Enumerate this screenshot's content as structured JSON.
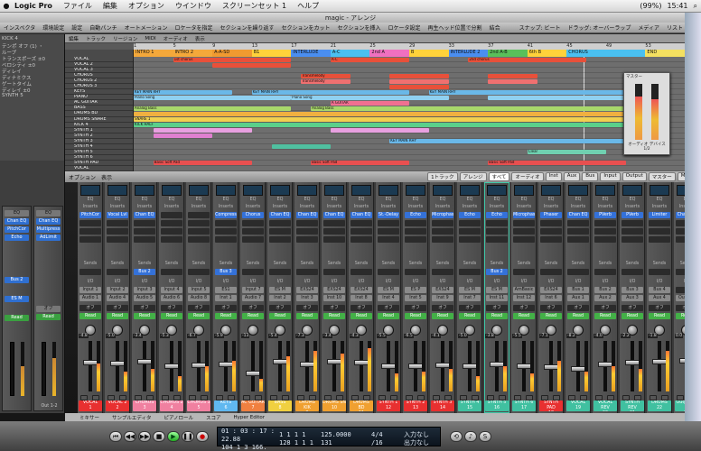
{
  "menubar": {
    "apple": "",
    "app": "Logic Pro",
    "items": [
      "ファイル",
      "編集",
      "オプション",
      "ウインドウ",
      "スクリーンセット 1",
      "ヘルプ"
    ],
    "clock": "15:41",
    "battery": "(99%)"
  },
  "window": {
    "title": "magic - アレンジ"
  },
  "toolbar": {
    "items": [
      "インスペクタ",
      "環境設定",
      "設定",
      "自動パンチ",
      "オートメーション",
      "ロケータを指定",
      "セクションを繰り返す",
      "セクションをカット",
      "セクションを挿入",
      "ロケータ設定",
      "再生ヘッド位置で分割",
      "結合"
    ],
    "right": [
      "スナップ: ビート",
      "ドラッグ: オーバーラップ",
      "メディア",
      "リスト",
      "メモ"
    ]
  },
  "inspector": {
    "top_items": [
      "KICK 4",
      "テンポ オフ (1) ・",
      "ループ",
      "トランスポーズ ±0",
      "ベロシティ ±0",
      "ディレイ",
      "ディナミクス",
      "ゲートタイム",
      "ディレイ ±0",
      "SYNTH 5"
    ],
    "left_plugs": [
      "Chan EQ",
      "PitchCor",
      "Echo"
    ],
    "right_plugs": [
      "Chan EQ",
      "Multipress",
      "AdLimit"
    ],
    "send": "Bus 2",
    "io": "ES M",
    "read": "Read",
    "auto": "オフ",
    "pan_val": "-4.4",
    "bottom": "Out 1-2"
  },
  "arrange": {
    "tools": [
      "編集",
      "トラック",
      "リージョン",
      "MIDI",
      "オーディオ",
      "表示"
    ],
    "ruler": [
      "1",
      "5",
      "9",
      "13",
      "17",
      "21",
      "25",
      "29",
      "33",
      "37",
      "41",
      "45",
      "49",
      "53",
      "57",
      "61",
      "65",
      "69",
      "73",
      "77",
      "81",
      "85",
      "89",
      "93",
      "97",
      "101",
      "105",
      "109"
    ],
    "markers": [
      {
        "label": "INTRO 1",
        "color": "#f4a83a",
        "start": 0,
        "len": 4
      },
      {
        "label": "INTRO 2",
        "color": "#f4a83a",
        "start": 4,
        "len": 4
      },
      {
        "label": "A-A-SD",
        "color": "#f09a30",
        "start": 8,
        "len": 4
      },
      {
        "label": "B1",
        "color": "#ffd23a",
        "start": 12,
        "len": 4
      },
      {
        "label": "INTERLUDE",
        "color": "#4a8ef0",
        "start": 16,
        "len": 4
      },
      {
        "label": "A-C",
        "color": "#4ac0f0",
        "start": 20,
        "len": 4
      },
      {
        "label": "2nd A",
        "color": "#f070c0",
        "start": 24,
        "len": 4
      },
      {
        "label": "B",
        "color": "#ffd23a",
        "start": 28,
        "len": 4
      },
      {
        "label": "INTERLUDE 2",
        "color": "#4a8ef0",
        "start": 32,
        "len": 4
      },
      {
        "label": "2nd A-B",
        "color": "#5ac05a",
        "start": 36,
        "len": 4
      },
      {
        "label": "6th B",
        "color": "#ffd23a",
        "start": 40,
        "len": 4
      },
      {
        "label": "CHORUS",
        "color": "#4ac0f0",
        "start": 44,
        "len": 8
      },
      {
        "label": "END",
        "color": "#f4e060",
        "start": 52,
        "len": 4
      }
    ],
    "tracks": [
      "VOCAL",
      "VOCAL 2",
      "VOCAL 3",
      "CHORUS",
      "CHORUS 2",
      "CHORUS 3",
      "KEYS",
      "PIANO",
      "AC GUITAR",
      "BASS",
      "DRUMS BD",
      "DRUMS SNARE",
      "KICK 4",
      "SYNTH 1",
      "SYNTH 2",
      "SYNTH 3",
      "SYNTH 4",
      "SYNTH 5",
      "SYNTH 6",
      "SYNTH PAD",
      "VOCAL"
    ],
    "regions": [
      {
        "track": 0,
        "label": "1st chorus",
        "start": 4,
        "len": 12,
        "color": "#e8503a"
      },
      {
        "track": 0,
        "label": "A-C",
        "start": 20,
        "len": 8,
        "color": "#e8503a"
      },
      {
        "track": 0,
        "label": "2nd chorus",
        "start": 34,
        "len": 12,
        "color": "#e8503a"
      },
      {
        "track": 1,
        "label": "",
        "start": 8,
        "len": 8,
        "color": "#e8503a"
      },
      {
        "track": 3,
        "label": "Transmelody",
        "start": 17,
        "len": 5,
        "color": "#e8503a"
      },
      {
        "track": 3,
        "label": "",
        "start": 26,
        "len": 6,
        "color": "#e8503a"
      },
      {
        "track": 3,
        "label": "",
        "start": 36,
        "len": 5,
        "color": "#e8503a"
      },
      {
        "track": 4,
        "label": "Transmelody",
        "start": 17,
        "len": 5,
        "color": "#f07070"
      },
      {
        "track": 4,
        "label": "",
        "start": 26,
        "len": 6,
        "color": "#f07070"
      },
      {
        "track": 4,
        "label": "",
        "start": 36,
        "len": 5,
        "color": "#f07070"
      },
      {
        "track": 5,
        "label": "",
        "start": 26,
        "len": 6,
        "color": "#e8503a"
      },
      {
        "track": 6,
        "label": "KEY MAIN RHY",
        "start": 0,
        "len": 10,
        "color": "#6ab8e8"
      },
      {
        "track": 6,
        "label": "KEY MAIN RHY",
        "start": 12,
        "len": 16,
        "color": "#6ab8e8"
      },
      {
        "track": 6,
        "label": "KEY MAIN RHY",
        "start": 30,
        "len": 24,
        "color": "#6ab8e8"
      },
      {
        "track": 7,
        "label": "Piano Song",
        "start": 0,
        "len": 16,
        "color": "#8fd0f0"
      },
      {
        "track": 7,
        "label": "Piano Song",
        "start": 16,
        "len": 16,
        "color": "#8fd0f0"
      },
      {
        "track": 7,
        "label": "",
        "start": 36,
        "len": 16,
        "color": "#8fd0f0"
      },
      {
        "track": 8,
        "label": "A GUITAR",
        "start": 20,
        "len": 8,
        "color": "#f07090"
      },
      {
        "track": 9,
        "label": "Analog Bass",
        "start": 0,
        "len": 16,
        "color": "#a8d86a"
      },
      {
        "track": 9,
        "label": "Analog Bass",
        "start": 18,
        "len": 34,
        "color": "#a8d86a"
      },
      {
        "track": 10,
        "label": "",
        "start": 0,
        "len": 52,
        "color": "#f0b040"
      },
      {
        "track": 11,
        "label": "SNARE 1",
        "start": 0,
        "len": 52,
        "color": "#f0d050"
      },
      {
        "track": 12,
        "label": "KICK HALF",
        "start": 0,
        "len": 52,
        "color": "#5ad08a"
      },
      {
        "track": 13,
        "label": "",
        "start": 2,
        "len": 10,
        "color": "#e8a0e0"
      },
      {
        "track": 13,
        "label": "",
        "start": 20,
        "len": 10,
        "color": "#e8a0e0"
      },
      {
        "track": 14,
        "label": "",
        "start": 2,
        "len": 6,
        "color": "#e080d0"
      },
      {
        "track": 15,
        "label": "KEY MAIN RHY",
        "start": 26,
        "len": 24,
        "color": "#6ab8e8"
      },
      {
        "track": 16,
        "label": "",
        "start": 14,
        "len": 6,
        "color": "#50c0a0"
      },
      {
        "track": 17,
        "label": "Clear",
        "start": 40,
        "len": 8,
        "color": "#70d0b0"
      },
      {
        "track": 19,
        "label": "Basic Soft Pad",
        "start": 2,
        "len": 10,
        "color": "#e85050"
      },
      {
        "track": 19,
        "label": "Basic Soft Pad",
        "start": 18,
        "len": 10,
        "color": "#e85050"
      },
      {
        "track": 19,
        "label": "Basic Soft Pad",
        "start": 36,
        "len": 14,
        "color": "#e85050"
      }
    ],
    "float": {
      "label": "オーディオ デバイス 1/2",
      "title": "マスター"
    }
  },
  "mixer": {
    "options": [
      "オプション",
      "表示"
    ],
    "tabs": [
      "1トラック",
      "アレンジ",
      "すべて",
      "オーディオ",
      "Inst",
      "Aux",
      "Bus",
      "Input",
      "Output",
      "マスター",
      "MIDI"
    ],
    "strips": [
      {
        "name": "VOCAL",
        "num": "1",
        "color": "#e83030",
        "insert": "PitchCor",
        "send": "",
        "io": "Input 1",
        "out": "Audio 1",
        "level": "-4.8",
        "meter": 0.55,
        "fader": 0.58,
        "knob": "-46"
      },
      {
        "name": "VOCAL 2",
        "num": "2",
        "color": "#e83030",
        "insert": "Vocal Lvl",
        "send": "",
        "io": "Input 2",
        "out": "Audio 4",
        "level": "-5.0",
        "meter": 0.4,
        "fader": 0.56,
        "knob": "-33"
      },
      {
        "name": "CHORUS",
        "num": "3",
        "color": "#f080a0",
        "insert": "Chan EQ",
        "send": "Bus 2",
        "io": "Input 3",
        "out": "Audio 5",
        "level": "-3.4",
        "meter": 0.45,
        "fader": 0.6,
        "knob": "+21"
      },
      {
        "name": "CHORUS 2",
        "num": "4",
        "color": "#f080a0",
        "insert": "",
        "send": "",
        "io": "Input 4",
        "out": "Audio 6",
        "level": "-5.3",
        "meter": 0.3,
        "fader": 0.5,
        "knob": "-64"
      },
      {
        "name": "CHORUS 3",
        "num": "5",
        "color": "#f080a0",
        "insert": "",
        "send": "",
        "io": "Input 5",
        "out": "Audio 8",
        "level": "-6.7",
        "meter": 0.5,
        "fader": 0.52,
        "knob": "+56"
      },
      {
        "name": "KEYS",
        "num": "6",
        "color": "#60b8f0",
        "insert": "Compress",
        "send": "Bus 3",
        "io": "ES1",
        "out": "Inst 1",
        "level": "-5.9",
        "meter": 0.6,
        "fader": 0.55,
        "knob": "+21"
      },
      {
        "name": "AC GUITAR",
        "num": "7",
        "color": "#f08040",
        "insert": "Chorus",
        "send": "",
        "io": "Input 7",
        "out": "Audio 7",
        "level": "-13",
        "meter": 0.25,
        "fader": 0.35,
        "knob": "-28"
      },
      {
        "name": "BASS",
        "num": "8",
        "color": "#f0d040",
        "insert": "Chan EQ",
        "send": "",
        "io": "ES M",
        "out": "Inst 2",
        "level": "-5.4",
        "meter": 0.7,
        "fader": 0.6,
        "knob": "0"
      },
      {
        "name": "DRUMS KIK",
        "num": "9",
        "color": "#f0a030",
        "insert": "Chan EQ",
        "send": "",
        "io": "EXS24",
        "out": "Inst 3",
        "level": "-7.3",
        "meter": 0.8,
        "fader": 0.55,
        "knob": "0"
      },
      {
        "name": "DRUMS SN",
        "num": "10",
        "color": "#f0a030",
        "insert": "Chan EQ",
        "send": "",
        "io": "EXS24",
        "out": "Inst 10",
        "level": "-3.4",
        "meter": 0.75,
        "fader": 0.6,
        "knob": "0"
      },
      {
        "name": "DRUMS BD",
        "num": "11",
        "color": "#f0a030",
        "insert": "Chan EQ",
        "send": "",
        "io": "EXS24",
        "out": "Inst 8",
        "level": "-4.3",
        "meter": 0.85,
        "fader": 0.58,
        "knob": "0"
      },
      {
        "name": "SYNTH 1",
        "num": "12",
        "color": "#e83030",
        "insert": "St.-Delay",
        "send": "",
        "io": "ES M",
        "out": "Inst 4",
        "level": "-5.5",
        "meter": 0.35,
        "fader": 0.5,
        "knob": "-38"
      },
      {
        "name": "SYNTH 2",
        "num": "13",
        "color": "#e83030",
        "insert": "Echo",
        "send": "",
        "io": "ES P",
        "out": "Inst 5",
        "level": "-6.5",
        "meter": 0.4,
        "fader": 0.5,
        "knob": "+26"
      },
      {
        "name": "SYNTH 3",
        "num": "14",
        "color": "#e83030",
        "insert": "Microphas",
        "send": "",
        "io": "EXS24",
        "out": "Inst 9",
        "level": "-4.1",
        "meter": 0.45,
        "fader": 0.52,
        "knob": "-20"
      },
      {
        "name": "SYNTH 4",
        "num": "15",
        "color": "#40c0a0",
        "insert": "Echo",
        "send": "",
        "io": "ES M",
        "out": "Inst 7",
        "level": "-5.0",
        "meter": 0.3,
        "fader": 0.5,
        "knob": "0"
      },
      {
        "name": "SYNTH 5",
        "num": "16",
        "color": "#40c0a0",
        "insert": "Echo",
        "send": "Bus 2",
        "io": "ES M",
        "out": "Inst 11",
        "level": "-3.8",
        "meter": 0.5,
        "fader": 0.55,
        "knob": "0"
      },
      {
        "name": "SYNTH 6",
        "num": "17",
        "color": "#40c0a0",
        "insert": "Microphas",
        "send": "",
        "io": "AmBasic",
        "out": "Inst 12",
        "level": "-5.5",
        "meter": 0.35,
        "fader": 0.5,
        "knob": "0"
      },
      {
        "name": "SYNTH PAD",
        "num": "18",
        "color": "#e83030",
        "insert": "Phaser",
        "send": "",
        "io": "EXS24",
        "out": "Inst 6",
        "level": "-7.1",
        "meter": 0.6,
        "fader": 0.48,
        "knob": "0"
      },
      {
        "name": "VOCAL",
        "num": "19",
        "color": "#40c0a0",
        "insert": "Chan EQ",
        "send": "",
        "io": "Bus 1",
        "out": "Aux 1",
        "level": "-8.2",
        "meter": 0.4,
        "fader": 0.45,
        "knob": "0"
      },
      {
        "name": "VOCAL REV",
        "num": "20",
        "color": "#40c0a0",
        "insert": "PVerb",
        "send": "",
        "io": "Bus 2",
        "out": "Aux 2",
        "level": "-4.0",
        "meter": 0.5,
        "fader": 0.55,
        "knob": "0"
      },
      {
        "name": "SYNTH REV",
        "num": "21",
        "color": "#40c0a0",
        "insert": "PVerb",
        "send": "",
        "io": "Bus 3",
        "out": "Aux 3",
        "level": "-2.2",
        "meter": 0.45,
        "fader": 0.58,
        "knob": "0"
      },
      {
        "name": "DRUMS",
        "num": "22",
        "color": "#40c0a0",
        "insert": "Limiter",
        "send": "",
        "io": "Bus 4",
        "out": "Aux 4",
        "level": "-1.8",
        "meter": 0.8,
        "fader": 0.6,
        "knob": "0"
      },
      {
        "name": "Output 1-2",
        "num": "23",
        "color": "#40c0a0",
        "insert": "Chan EQ",
        "send": "",
        "io": "",
        "out": "Out 1-2",
        "level": "0.0",
        "meter": 0.9,
        "fader": 0.62,
        "knob": "0"
      }
    ],
    "labels": {
      "eq": "EQ",
      "inserts": "Inserts",
      "sends": "Sends",
      "io": "I/O",
      "auto": "Read",
      "group": "グループ",
      "auto_off": "オフ"
    }
  },
  "bottomtabs": [
    "ミキサー",
    "サンプルエディタ",
    "ピアノロール",
    "スコア",
    "Hyper Editor"
  ],
  "transport": {
    "smpte": "01 : 03 : 17 : 22.88",
    "bars": "104  1  3  166.",
    "pos": "128  1  1  1",
    "pos2": "1  1  1  1",
    "tempo": "125.0000",
    "sig": "4/4",
    "div": "/16",
    "in": "入力なし",
    "out": "出力なし",
    "loop": "131",
    "end": "/32"
  }
}
